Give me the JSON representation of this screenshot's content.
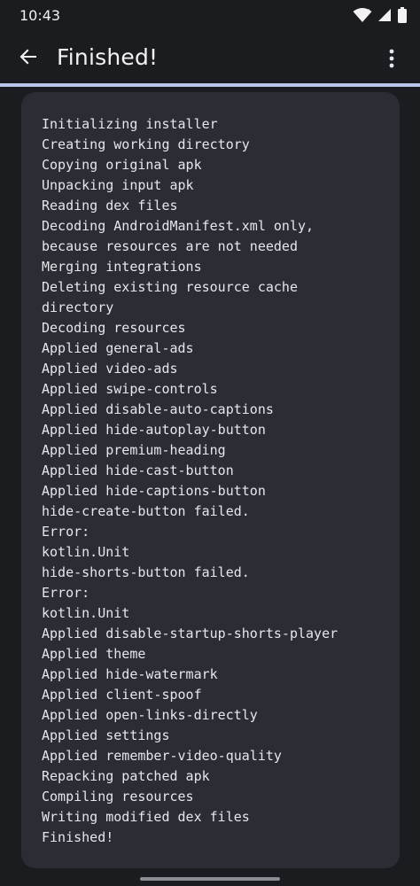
{
  "status_bar": {
    "time": "10:43",
    "icons": [
      "wifi-icon",
      "signal-icon",
      "battery-icon"
    ]
  },
  "app_bar": {
    "title": "Finished!",
    "back_icon": "arrow-back-icon",
    "menu_icon": "more-vert-icon"
  },
  "progress": {
    "fraction": 1.0
  },
  "log": {
    "lines": [
      "Initializing installer",
      "Creating working directory",
      "Copying original apk",
      "Unpacking input apk",
      "Reading dex files",
      "Decoding AndroidManifest.xml only,",
      "because resources are not needed",
      "Merging integrations",
      "Deleting existing resource cache",
      "directory",
      "Decoding resources",
      "Applied general-ads",
      "Applied video-ads",
      "Applied swipe-controls",
      "Applied disable-auto-captions",
      "Applied hide-autoplay-button",
      "Applied premium-heading",
      "Applied hide-cast-button",
      "Applied hide-captions-button",
      "hide-create-button failed.",
      "Error:",
      "kotlin.Unit",
      "hide-shorts-button failed.",
      "Error:",
      "kotlin.Unit",
      "Applied disable-startup-shorts-player",
      "Applied theme",
      "Applied hide-watermark",
      "Applied client-spoof",
      "Applied open-links-directly",
      "Applied settings",
      "Applied remember-video-quality",
      "Repacking patched apk",
      "Compiling resources",
      "Writing modified dex files",
      "Finished!"
    ]
  },
  "colors": {
    "background": "#1b1c20",
    "card": "#2a2d34",
    "accent": "#b9c5e8",
    "text": "#e6e7ec"
  }
}
